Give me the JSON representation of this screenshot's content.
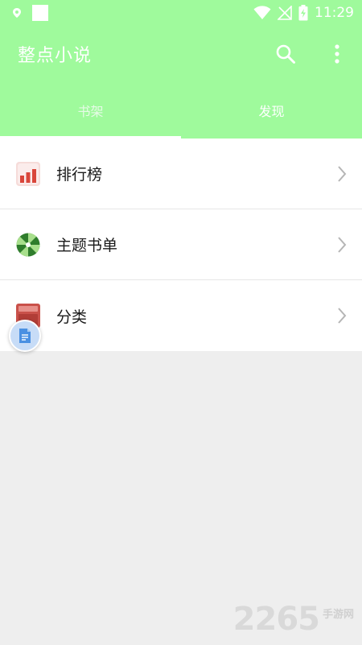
{
  "status_bar": {
    "time": "11:29"
  },
  "toolbar": {
    "title": "整点小说",
    "search_icon": "search-icon",
    "more_icon": "more-vert-icon"
  },
  "tabs": [
    {
      "label": "书架",
      "selected": false
    },
    {
      "label": "发现",
      "selected": true
    }
  ],
  "discover_list": [
    {
      "label": "排行榜",
      "icon": "ranking-chart-icon"
    },
    {
      "label": "主题书单",
      "icon": "theme-booklist-icon"
    },
    {
      "label": "分类",
      "icon": "category-box-icon"
    }
  ],
  "floating_button": {
    "icon": "document-icon"
  },
  "watermark": {
    "number": "2265",
    "text": "手游网"
  },
  "colors": {
    "accent": "#9ffa9c",
    "background": "#eeeeee",
    "list_background": "#ffffff",
    "text_primary": "#1a1a1a",
    "divider": "#e6e6e6"
  }
}
